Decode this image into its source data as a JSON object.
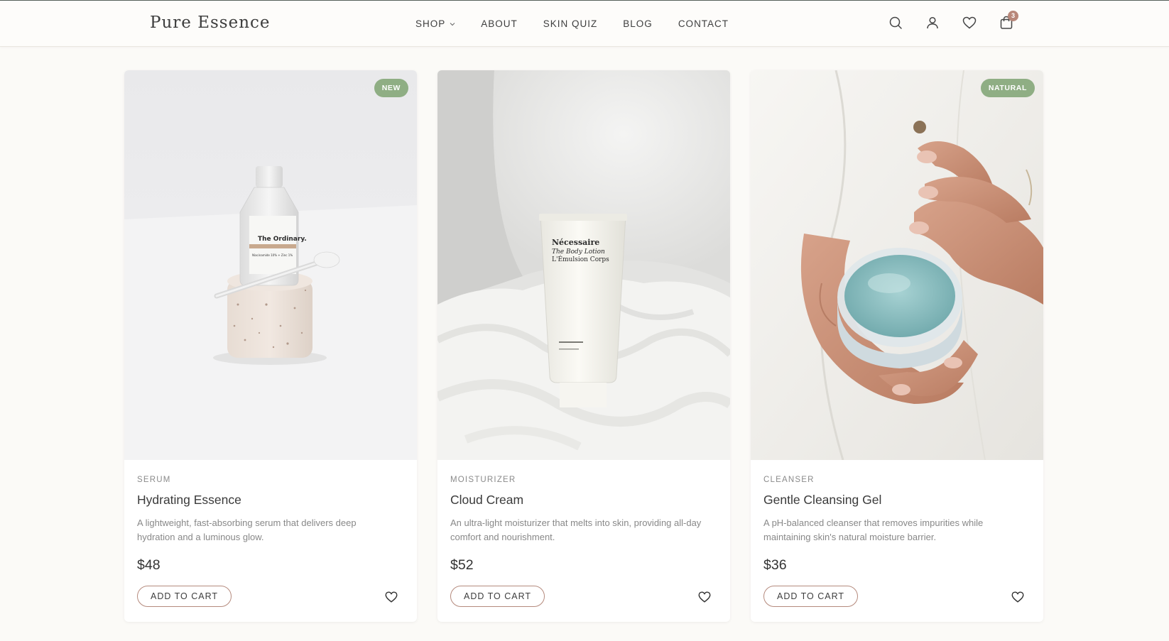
{
  "brand": {
    "name": "Pure Essence"
  },
  "nav": {
    "items": [
      {
        "label": "SHOP",
        "has_dropdown": true
      },
      {
        "label": "ABOUT"
      },
      {
        "label": "SKIN QUIZ"
      },
      {
        "label": "BLOG"
      },
      {
        "label": "CONTACT"
      }
    ]
  },
  "header_icons": {
    "search": "search-icon",
    "account": "user-icon",
    "wishlist": "heart-icon",
    "cart": "shopping-bag-icon",
    "cart_count": "3"
  },
  "colors": {
    "accent": "#b8877a",
    "badge_green": "#8fae84",
    "background": "#fbfaf7"
  },
  "products": [
    {
      "badge": "NEW",
      "category": "SERUM",
      "title": "Hydrating Essence",
      "description": "A lightweight, fast-absorbing serum that delivers deep hydration and a luminous glow.",
      "price": "$48",
      "cta": "ADD TO CART",
      "image": {
        "subject": "serum-dropper-bottle",
        "bottle_brand": "The Ordinary.",
        "bottle_product": "Niacinamide 10% + Zinc 1%"
      }
    },
    {
      "badge": "",
      "category": "MOISTURIZER",
      "title": "Cloud Cream",
      "description": "An ultra-light moisturizer that melts into skin, providing all-day comfort and nourishment.",
      "price": "$52",
      "cta": "ADD TO CART",
      "image": {
        "subject": "lotion-tube",
        "tube_brand": "Nécessaire",
        "tube_line1": "The Body Lotion",
        "tube_line2": "L'Émulsion Corps"
      }
    },
    {
      "badge": "NATURAL",
      "category": "CLEANSER",
      "title": "Gentle Cleansing Gel",
      "description": "A pH-balanced cleanser that removes impurities while maintaining skin's natural moisture barrier.",
      "price": "$36",
      "cta": "ADD TO CART",
      "image": {
        "subject": "gel-jar-in-hands"
      }
    }
  ]
}
